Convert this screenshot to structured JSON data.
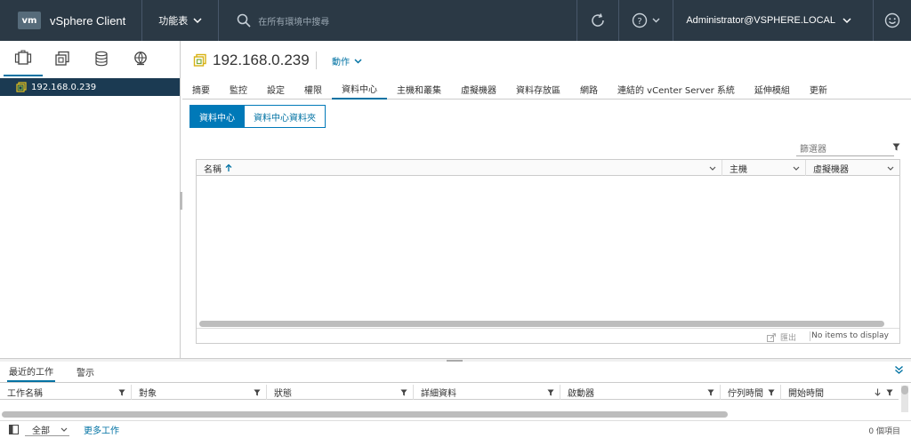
{
  "header": {
    "logo": "vm",
    "app_title": "vSphere Client",
    "menu_label": "功能表",
    "search_placeholder": "在所有環境中搜尋",
    "user": "Administrator@VSPHERE.LOCAL"
  },
  "navigator": {
    "tabs": [
      {
        "icon": "hosts-and-clusters-icon"
      },
      {
        "icon": "vms-and-templates-icon"
      },
      {
        "icon": "storage-icon"
      },
      {
        "icon": "networking-icon"
      }
    ],
    "tree": [
      {
        "label": "192.168.0.239",
        "icon": "vcenter-server-icon"
      }
    ]
  },
  "object": {
    "title": "192.168.0.239",
    "actions_label": "動作"
  },
  "tabs": [
    "摘要",
    "監控",
    "設定",
    "權限",
    "資料中心",
    "主機和叢集",
    "虛擬機器",
    "資料存放區",
    "網路",
    "連結的 vCenter Server 系統",
    "延伸模組",
    "更新"
  ],
  "active_tab": "資料中心",
  "segments": [
    "資料中心",
    "資料中心資料夾"
  ],
  "filter_placeholder": "篩選器",
  "grid": {
    "columns": [
      "名稱",
      "主機",
      "虛擬機器"
    ],
    "export_label": "匯出",
    "no_items": "No items to display"
  },
  "tasks": {
    "tabs": [
      "最近的工作",
      "警示"
    ],
    "columns": [
      "工作名稱",
      "對象",
      "狀態",
      "詳細資料",
      "啟動器",
      "佇列時間",
      "開始時間"
    ],
    "filter_select": "全部",
    "more_tasks": "更多工作",
    "count": "0 個項目"
  },
  "colors": {
    "header_bg": "#2b3945",
    "accent": "#0072a3",
    "tree_selected": "#1b3a52"
  }
}
